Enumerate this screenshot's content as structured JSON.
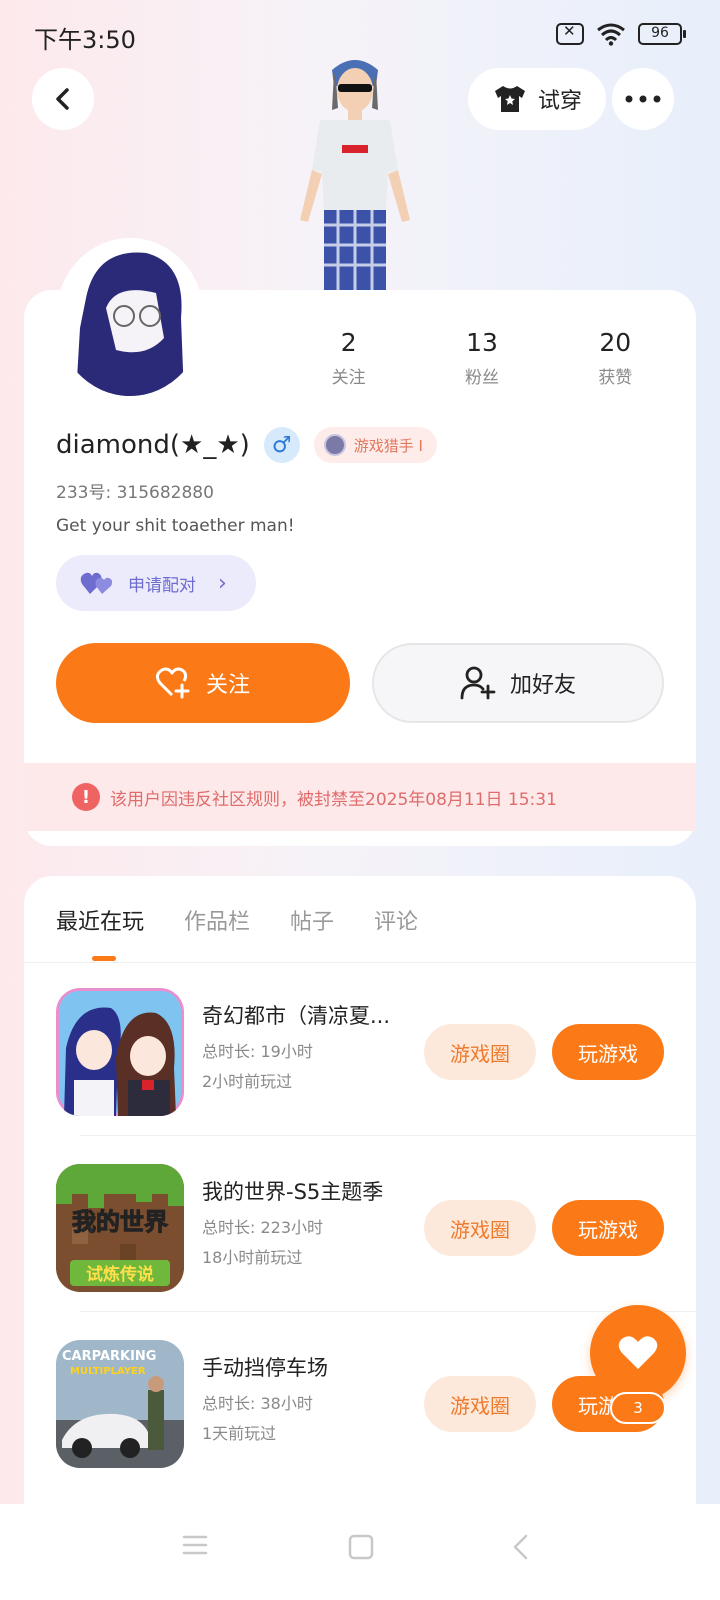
{
  "status_bar": {
    "time": "下午3:50",
    "battery": "96"
  },
  "header": {
    "try_on_label": "试穿"
  },
  "stats": [
    {
      "value": "2",
      "label": "关注"
    },
    {
      "value": "13",
      "label": "粉丝"
    },
    {
      "value": "20",
      "label": "获赞"
    }
  ],
  "profile": {
    "username": "diamond(★_★)",
    "gender_symbol": "♂",
    "title_badge": "游戏猎手 I",
    "user_id": "233号: 315682880",
    "bio": "Get your shit toaether man!",
    "match_label": "申请配对"
  },
  "actions": {
    "follow_label": "关注",
    "add_friend_label": "加好友"
  },
  "ban_notice": "该用户因违反社区规则，被封禁至2025年08月11日 15:31",
  "tabs": [
    {
      "label": "最近在玩",
      "active": true
    },
    {
      "label": "作品栏",
      "active": false
    },
    {
      "label": "帖子",
      "active": false
    },
    {
      "label": "评论",
      "active": false
    }
  ],
  "games": [
    {
      "name": "奇幻都市（清凉夏...",
      "playtime": "总时长: 19小时",
      "last_played": "2小时前玩过",
      "circle_label": "游戏圈",
      "play_label": "玩游戏"
    },
    {
      "name": "我的世界-S5主题季",
      "playtime": "总时长: 223小时",
      "last_played": "18小时前玩过",
      "circle_label": "游戏圈",
      "play_label": "玩游戏",
      "thumb_text_top": "我的世界",
      "thumb_text_bottom": "试炼传说"
    },
    {
      "name": "手动挡停车场",
      "playtime": "总时长: 38小时",
      "last_played": "1天前玩过",
      "circle_label": "游戏圈",
      "play_label": "玩游戏",
      "thumb_text_top": "CARPARKING",
      "thumb_text_bottom": "MULTIPLAYER"
    }
  ],
  "fab": {
    "count": "3"
  },
  "colors": {
    "accent": "#fb7a17",
    "ban_text": "#e06b6b",
    "match_text": "#6e6ccf"
  }
}
